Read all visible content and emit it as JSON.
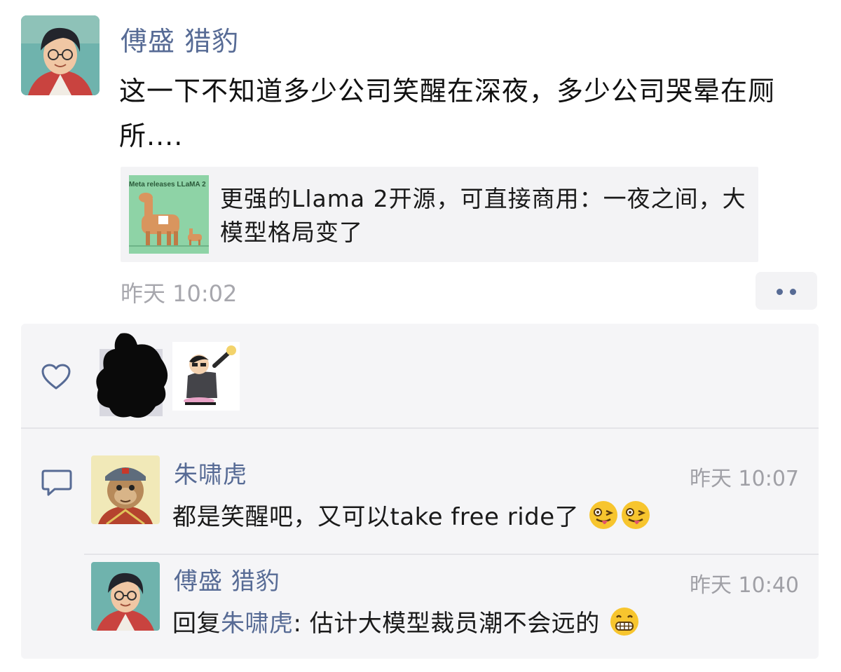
{
  "post": {
    "author": "傅盛 猎豹",
    "text": "这一下不知道多少公司笑醒在深夜，多少公司哭晕在厕所....",
    "link": {
      "thumb_text": "Meta releases LLaMA 2",
      "title": "更强的Llama 2开源，可直接商用：一夜之间，大模型格局变了"
    },
    "timestamp": "昨天 10:02"
  },
  "comments": [
    {
      "name": "朱啸虎",
      "time": "昨天 10:07",
      "text": "都是笑醒吧，又可以take free ride了",
      "emojis": [
        "tongue-wink-emoji",
        "tongue-wink-emoji"
      ]
    },
    {
      "name": "傅盛 猎豹",
      "time": "昨天 10:40",
      "reply_prefix": "回复",
      "reply_to": "朱啸虎",
      "text": ": 估计大模型裁员潮不会远的",
      "emojis": [
        "grin-emoji"
      ]
    }
  ],
  "colors": {
    "name_blue": "#576b95",
    "time_gray": "#a7a7ad",
    "panel_bg": "#f5f5f7"
  },
  "icons": [
    "heart-icon",
    "comment-icon",
    "more-dots-icon"
  ]
}
